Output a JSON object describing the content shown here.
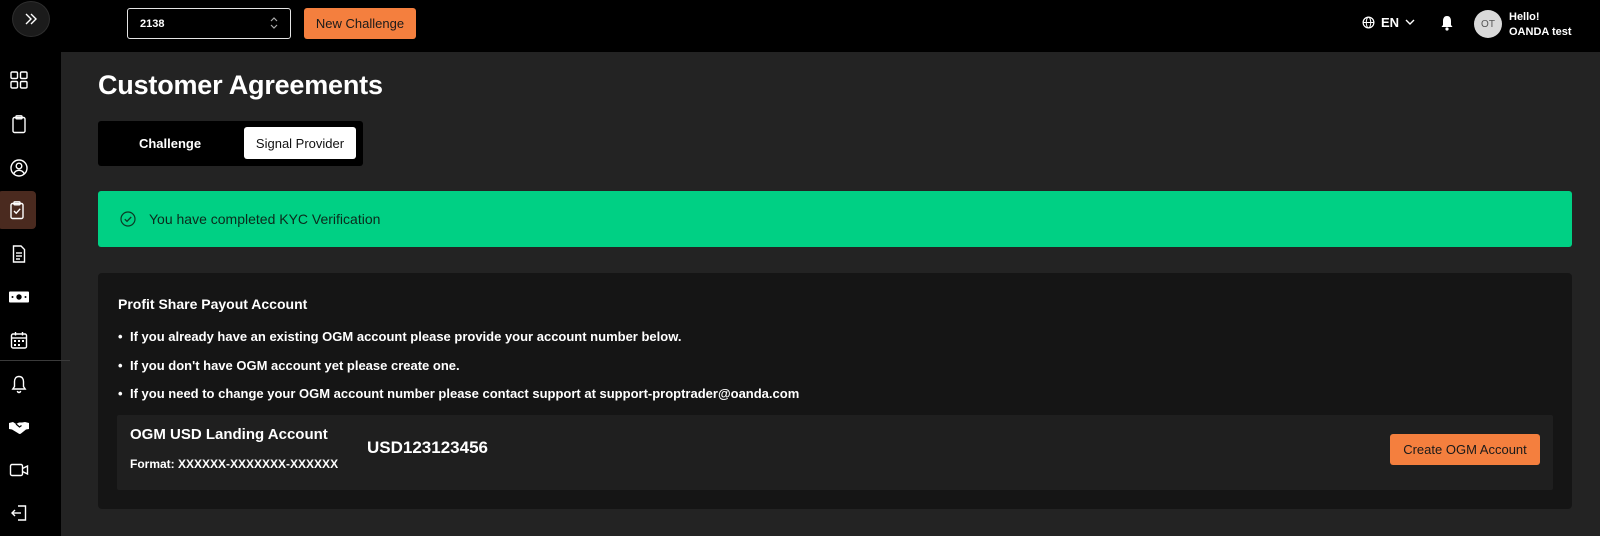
{
  "topbar": {
    "account_select_value": "2138",
    "new_challenge_label": "New Challenge",
    "language": "EN",
    "avatar_initials": "OT",
    "greeting_line1": "Hello!",
    "greeting_line2": "OANDA test"
  },
  "sidebar": {
    "items": [
      {
        "icon": "dashboard-icon"
      },
      {
        "icon": "clipboard-icon"
      },
      {
        "icon": "profile-icon"
      },
      {
        "icon": "agreements-icon",
        "active": true
      },
      {
        "icon": "document-icon"
      },
      {
        "icon": "money-icon"
      },
      {
        "icon": "calendar-icon"
      },
      {
        "icon": "notification-bell-icon"
      },
      {
        "icon": "handshake-icon"
      },
      {
        "icon": "video-icon"
      },
      {
        "icon": "logout-icon"
      }
    ]
  },
  "page": {
    "title": "Customer Agreements",
    "tabs": [
      "Challenge",
      "Signal Provider"
    ],
    "active_tab": "Signal Provider"
  },
  "kyc": {
    "message": "You have completed KYC Verification"
  },
  "payout": {
    "title": "Profit Share Payout Account",
    "bullets": [
      "If you already have an existing OGM account please provide your account number below.",
      "If you don't have OGM account yet please create one.",
      "If you need to change your OGM account number please contact support at support-proptrader@oanda.com"
    ],
    "account_name": "OGM USD Landing Account",
    "account_format": "Format: XXXXXX-XXXXXXX-XXXXXX",
    "account_number": "USD123123456",
    "create_button_label": "Create OGM Account"
  },
  "colors": {
    "accent_orange": "#f47f3e",
    "success_green": "#00d084",
    "active_nav_bg": "#4a2a1f"
  }
}
